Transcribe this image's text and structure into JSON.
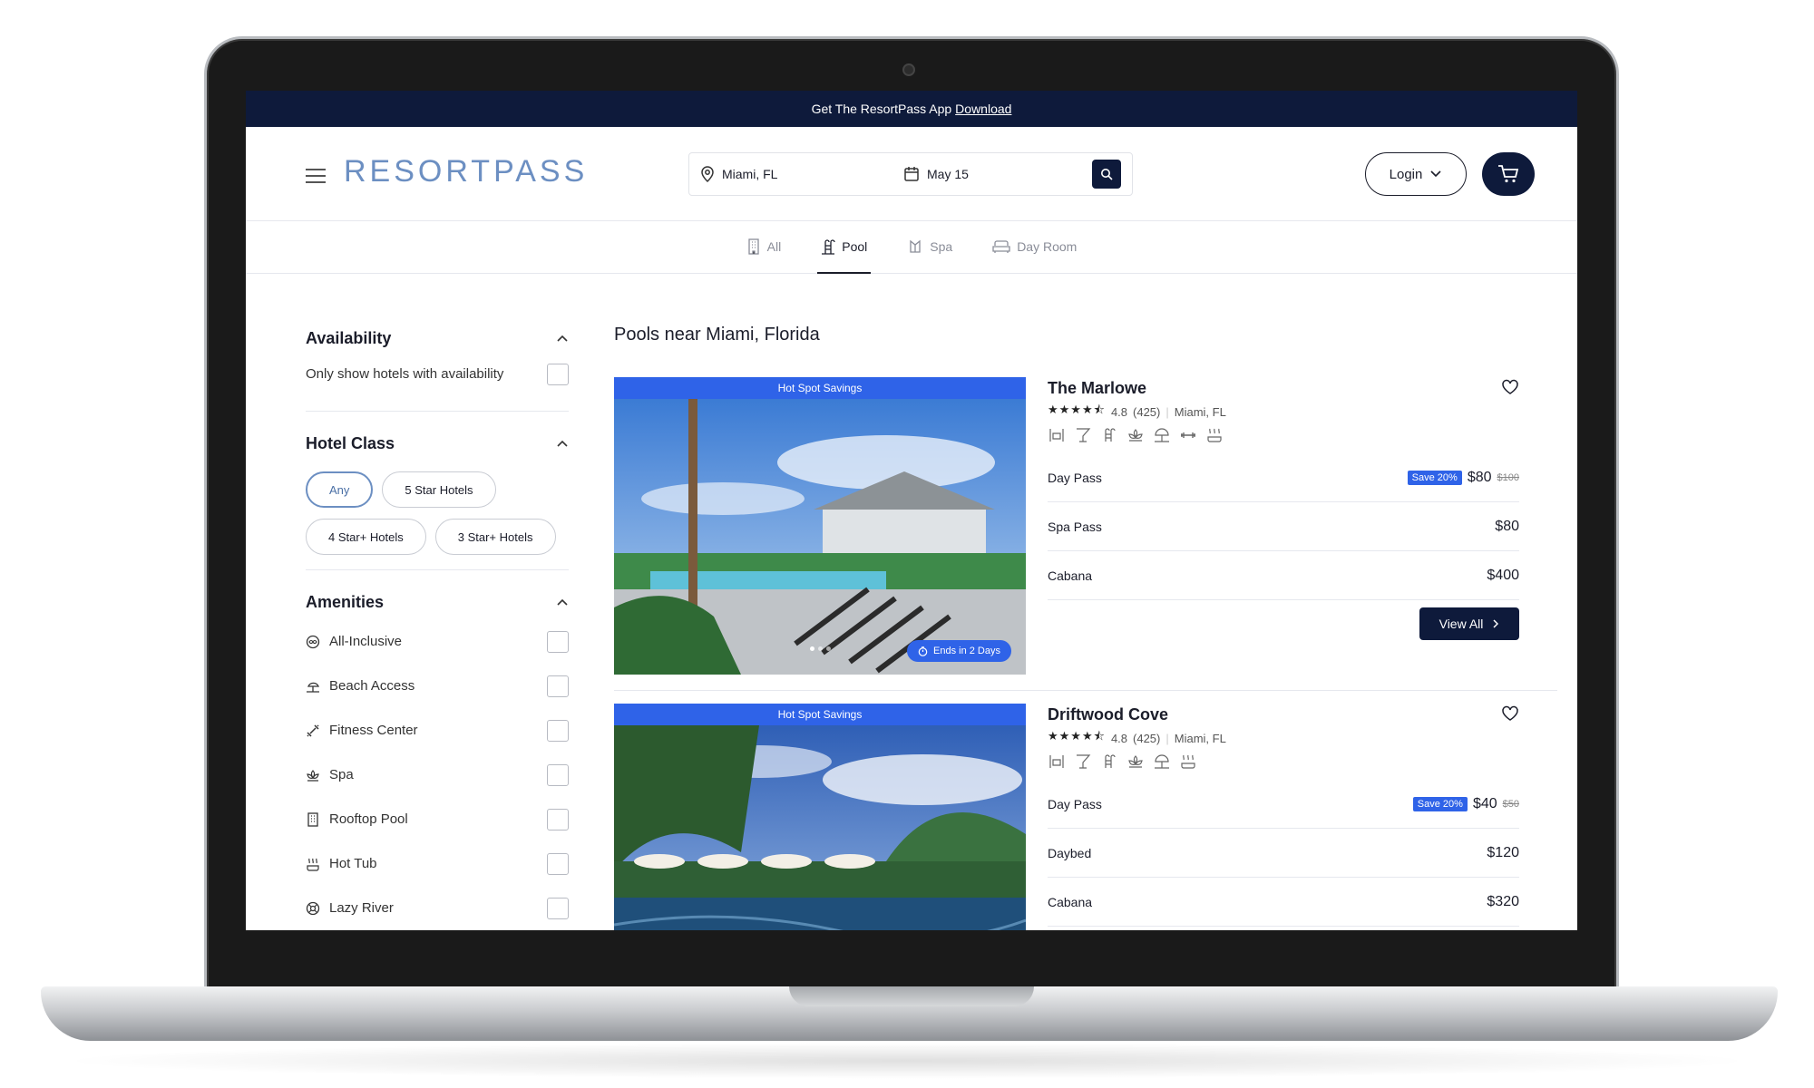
{
  "promo": {
    "text": "Get The ResortPass App",
    "link": "Download"
  },
  "header": {
    "logo": "RESORTPASS",
    "location": "Miami, FL",
    "date": "May 15",
    "login_label": "Login"
  },
  "tabs": [
    {
      "label": "All",
      "icon": "building-icon"
    },
    {
      "label": "Pool",
      "icon": "pool-ladder-icon"
    },
    {
      "label": "Spa",
      "icon": "spa-icon"
    },
    {
      "label": "Day Room",
      "icon": "sofa-icon"
    }
  ],
  "sidebar": {
    "availability": {
      "title": "Availability",
      "option": "Only show hotels with availability"
    },
    "hotel_class": {
      "title": "Hotel Class",
      "options": [
        "Any",
        "5 Star Hotels",
        "4 Star+ Hotels",
        "3 Star+ Hotels"
      ]
    },
    "amenities": {
      "title": "Amenities",
      "items": [
        {
          "label": "All-Inclusive",
          "icon": "infinity-icon"
        },
        {
          "label": "Beach Access",
          "icon": "beach-icon"
        },
        {
          "label": "Fitness Center",
          "icon": "dumbbell-icon"
        },
        {
          "label": "Spa",
          "icon": "lotus-icon"
        },
        {
          "label": "Rooftop Pool",
          "icon": "building-icon"
        },
        {
          "label": "Hot Tub",
          "icon": "hot-tub-icon"
        },
        {
          "label": "Lazy River",
          "icon": "tube-icon"
        }
      ]
    }
  },
  "results": {
    "title": "Pools near Miami, Florida",
    "cards": [
      {
        "badge": "Hot Spot Savings",
        "ends": "Ends in 2 Days",
        "name": "The Marlowe",
        "rating": "4.8",
        "reviews": "(425)",
        "city": "Miami, FL",
        "products": [
          {
            "name": "Day Pass",
            "save": "Save 20%",
            "price": "$80",
            "old": "$100"
          },
          {
            "name": "Spa Pass",
            "price": "$80"
          },
          {
            "name": "Cabana",
            "price": "$400"
          }
        ],
        "cta": "View All"
      },
      {
        "badge": "Hot Spot Savings",
        "name": "Driftwood Cove",
        "rating": "4.8",
        "reviews": "(425)",
        "city": "Miami, FL",
        "products": [
          {
            "name": "Day Pass",
            "save": "Save 20%",
            "price": "$40",
            "old": "$50"
          },
          {
            "name": "Daybed",
            "price": "$120"
          },
          {
            "name": "Cabana",
            "price": "$320"
          }
        ]
      }
    ]
  },
  "colors": {
    "navy": "#0e1a3b",
    "accent_blue": "#2f63e8",
    "logo_blue": "#6c8fc2"
  }
}
